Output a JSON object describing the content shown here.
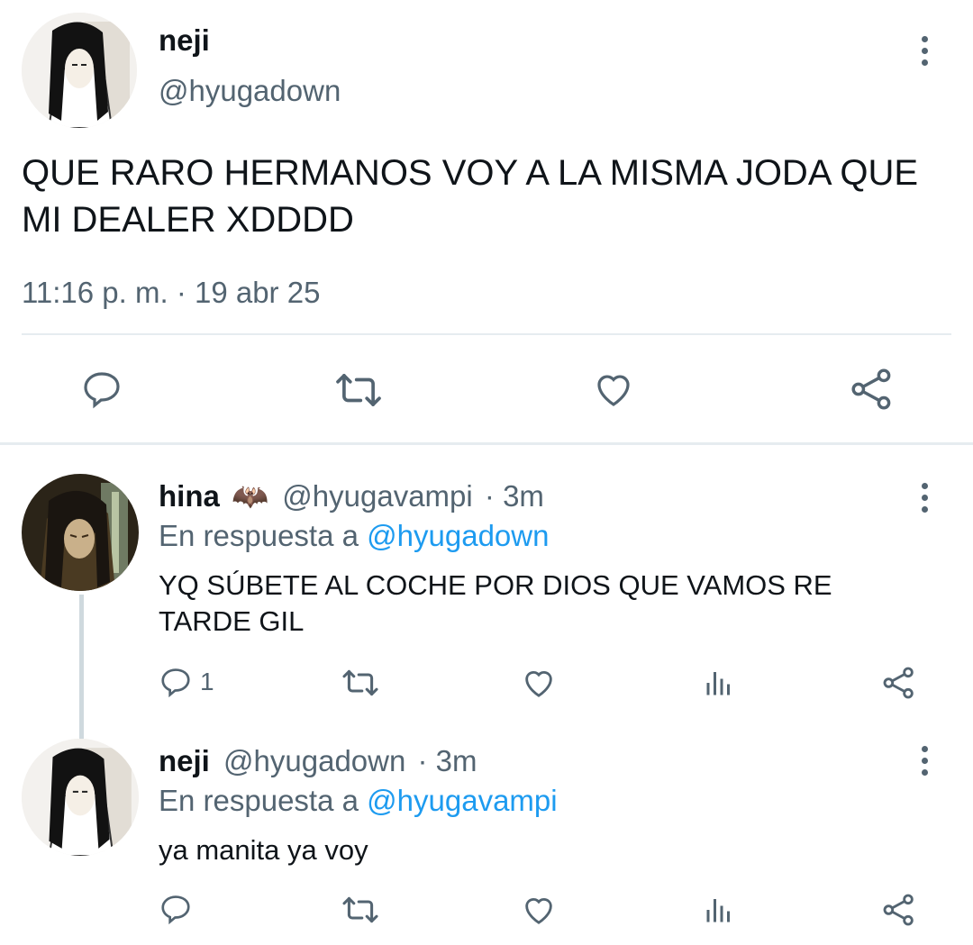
{
  "main_tweet": {
    "display_name": "neji",
    "handle": "@hyugadown",
    "text": "QUE RARO HERMANOS VOY A LA MISMA JODA QUE MI DEALER XDDDD",
    "timestamp": "11:16 p. m. · 19 abr 25"
  },
  "replies": [
    {
      "display_name": "hina",
      "emoji": "🦇",
      "handle": "@hyugavampi",
      "time": "· 3m",
      "reply_prefix": "En respuesta a",
      "reply_to": "@hyugadown",
      "text": "YQ SÚBETE AL COCHE POR DIOS QUE VAMOS RE TARDE GIL",
      "reply_count": "1"
    },
    {
      "display_name": "neji",
      "handle": "@hyugadown",
      "time": "· 3m",
      "reply_prefix": "En respuesta a",
      "reply_to": "@hyugavampi",
      "text": "ya manita ya voy",
      "reply_count": ""
    }
  ],
  "colors": {
    "accent": "#1d9bf0",
    "muted": "#536471",
    "divider": "#e6ecf0"
  }
}
